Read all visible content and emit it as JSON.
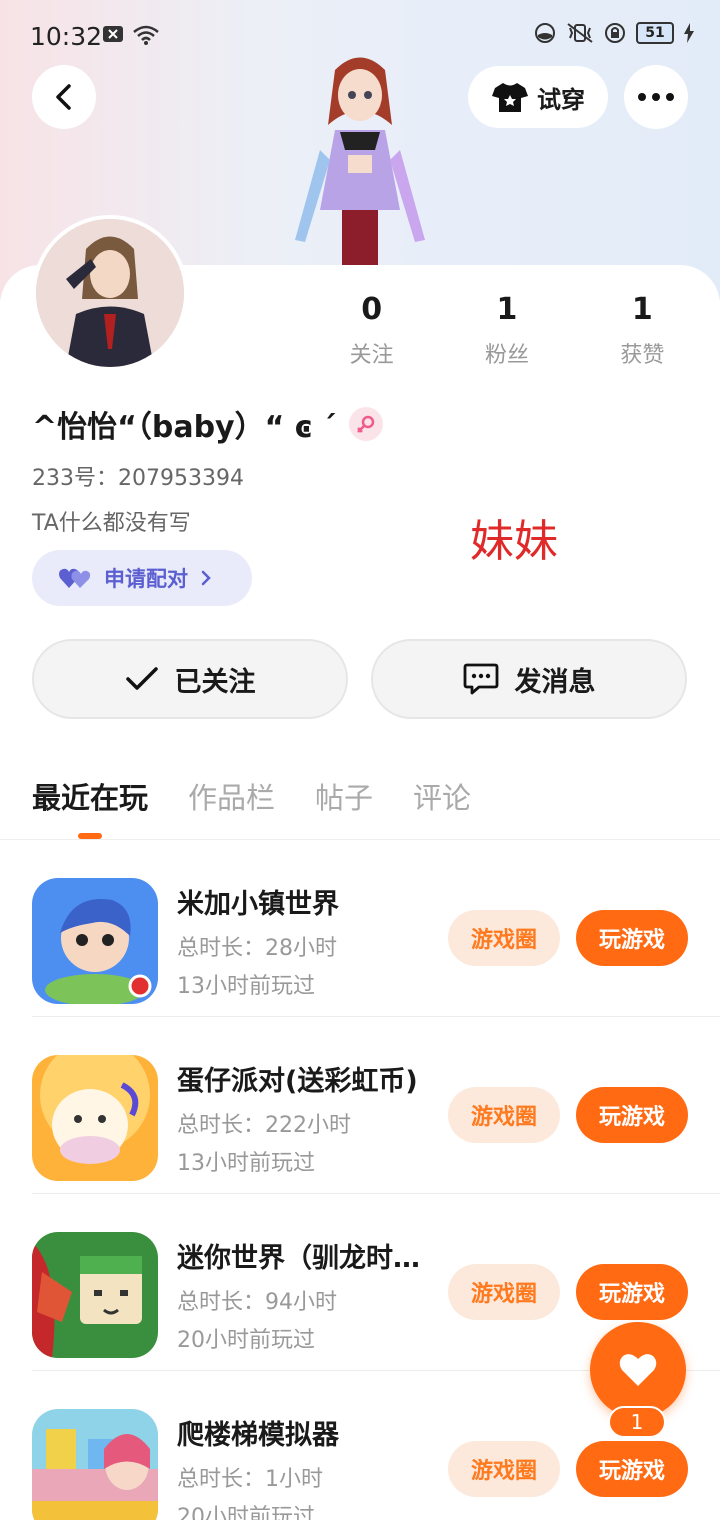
{
  "status_bar": {
    "time": "10:32",
    "battery": "51"
  },
  "header": {
    "try_on_label": "试穿"
  },
  "profile": {
    "stats": [
      {
        "value": "0",
        "label": "关注"
      },
      {
        "value": "1",
        "label": "粉丝"
      },
      {
        "value": "1",
        "label": "获赞"
      }
    ],
    "nickname": "^怡怡“（baby）“ ͼ ˊ",
    "uid_text": "233号：207953394",
    "bio": "TA什么都没有写",
    "overlay_text": "妹妹",
    "pair_label": "申请配对"
  },
  "actions": {
    "follow_label": "已关注",
    "message_label": "发消息"
  },
  "tabs": [
    {
      "label": "最近在玩",
      "active": true
    },
    {
      "label": "作品栏",
      "active": false
    },
    {
      "label": "帖子",
      "active": false
    },
    {
      "label": "评论",
      "active": false
    }
  ],
  "games": [
    {
      "title": "米加小镇世界",
      "duration": "总时长：28小时",
      "last_played": "13小时前玩过",
      "circle_label": "游戏圈",
      "play_label": "玩游戏"
    },
    {
      "title": "蛋仔派对(送彩虹币)",
      "duration": "总时长：222小时",
      "last_played": "13小时前玩过",
      "circle_label": "游戏圈",
      "play_label": "玩游戏"
    },
    {
      "title": "迷你世界（驯龙时…",
      "duration": "总时长：94小时",
      "last_played": "20小时前玩过",
      "circle_label": "游戏圈",
      "play_label": "玩游戏"
    },
    {
      "title": "爬楼梯模拟器",
      "duration": "总时长：1小时",
      "last_played": "20小时前玩过",
      "circle_label": "游戏圈",
      "play_label": "玩游戏"
    }
  ],
  "floating": {
    "like_count": "1"
  },
  "colors": {
    "accent": "#ff6a13",
    "accent_soft": "#fde9dc",
    "pair_bg": "#e9ebfb",
    "pair_text": "#5b5fd0",
    "overlay_red": "#e02a2a"
  }
}
